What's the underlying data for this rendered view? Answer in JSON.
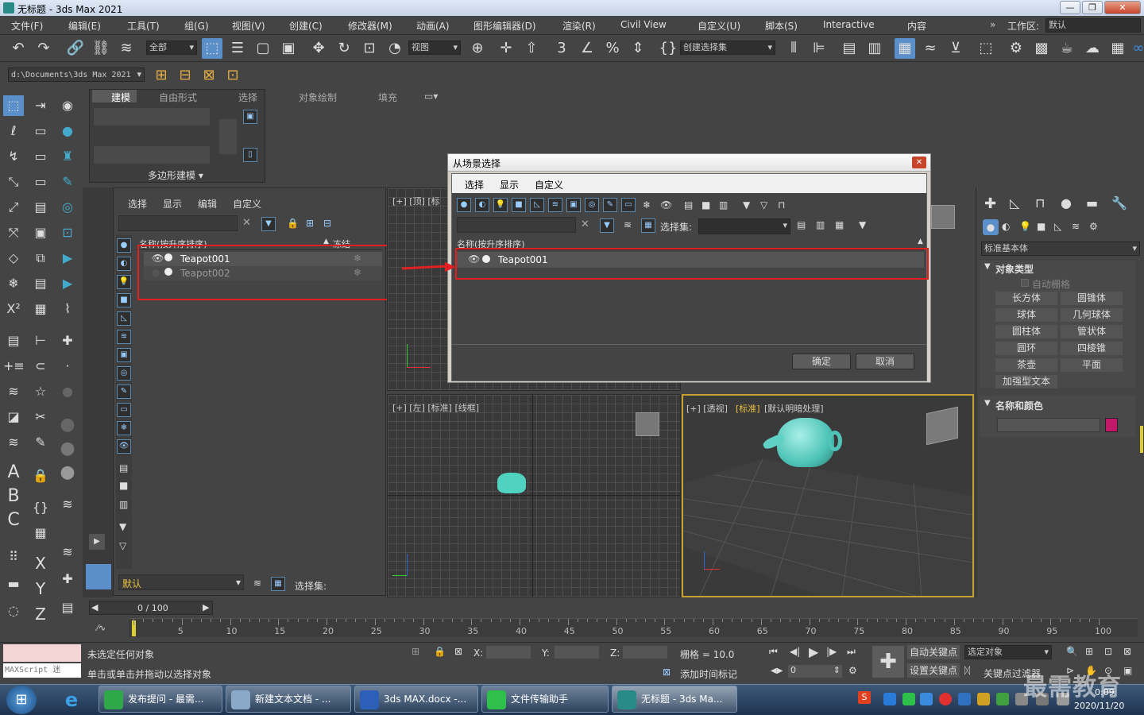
{
  "window": {
    "title": "无标题 - 3ds Max 2021",
    "min": "—",
    "max": "❐",
    "close": "✕"
  },
  "menu": [
    "文件(F)",
    "编辑(E)",
    "工具(T)",
    "组(G)",
    "视图(V)",
    "创建(C)",
    "修改器(M)",
    "动画(A)",
    "图形编辑器(D)",
    "渲染(R)",
    "Civil View",
    "自定义(U)",
    "脚本(S)",
    "Interactive",
    "内容"
  ],
  "workspace": {
    "label": "工作区:",
    "value": "默认"
  },
  "toolbar": {
    "filter": "全部",
    "ref_coord": "视图",
    "selection_set": "创建选择集"
  },
  "path": "d:\\Documents\\3ds Max 2021",
  "ribbon": {
    "tabs": [
      "建模",
      "自由形式",
      "选择",
      "对象绘制",
      "填充"
    ],
    "active": "建模",
    "group": "多边形建模"
  },
  "scene_explorer": {
    "menu": [
      "选择",
      "显示",
      "编辑",
      "自定义"
    ],
    "col_name": "名称(按升序排序)",
    "col_freeze": "冻结",
    "items": [
      {
        "name": "Teapot001"
      },
      {
        "name": "Teapot002"
      }
    ],
    "layer": "默认",
    "selset": "选择集:"
  },
  "viewports": {
    "top": "[+] [顶] [标",
    "left": "[+] [左] [标准] [线框]",
    "persp_a": "[+] [透视]",
    "persp_b": "[标准]",
    "persp_c": "[默认明暗处理]"
  },
  "dialog": {
    "title": "从场景选择",
    "menu": [
      "选择",
      "显示",
      "自定义"
    ],
    "selset": "选择集:",
    "col_name": "名称(按升序排序)",
    "items": [
      {
        "name": "Teapot001"
      }
    ],
    "ok": "确定",
    "cancel": "取消"
  },
  "cmd_panel": {
    "category": "标准基本体",
    "rollout_obj": "对象类型",
    "autogrid": "自动栅格",
    "buttons": [
      "长方体",
      "圆锥体",
      "球体",
      "几何球体",
      "圆柱体",
      "管状体",
      "圆环",
      "四棱锥",
      "茶壶",
      "平面",
      "加强型文本"
    ],
    "rollout_name": "名称和颜色",
    "color": "#c2186a"
  },
  "timeline": {
    "frame": "0 / 100",
    "ticks": [
      "0",
      "5",
      "10",
      "15",
      "20",
      "25",
      "30",
      "35",
      "40",
      "45",
      "50",
      "55",
      "60",
      "65",
      "70",
      "75",
      "80",
      "85",
      "90",
      "95",
      "100"
    ]
  },
  "status": {
    "maxscript": "MAXScript 迷",
    "line1": "未选定任何对象",
    "line2": "单击或单击并拖动以选择对象",
    "x": "X:",
    "y": "Y:",
    "z": "Z:",
    "grid": "栅格 = 10.0",
    "addtime": "添加时间标记",
    "autokey": "自动关键点",
    "setkey": "设置关键点",
    "selobj": "选定对象",
    "keyfilter": "关键点过滤器",
    "frame": "0"
  },
  "taskbar": {
    "items": [
      "发布提问 - 最需...",
      "新建文本文档 - ...",
      "3ds MAX.docx -...",
      "文件传输助手",
      "无标题 - 3ds Ma..."
    ],
    "time": "0:09",
    "date": "2020/11/20",
    "watermark": "最需教育"
  }
}
